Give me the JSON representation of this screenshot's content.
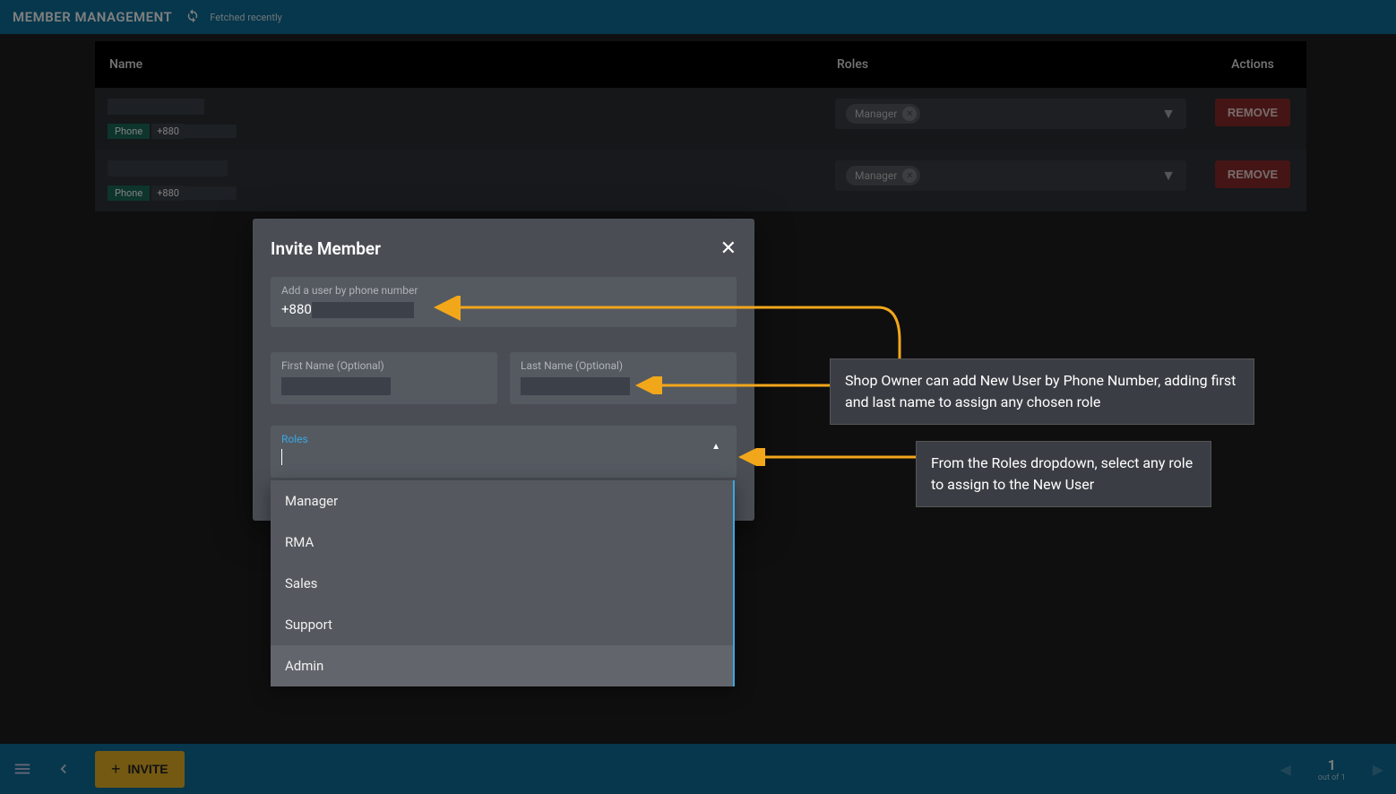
{
  "topbar": {
    "title": "MEMBER MANAGEMENT",
    "fetched": "Fetched recently"
  },
  "table": {
    "headers": {
      "name": "Name",
      "roles": "Roles",
      "actions": "Actions"
    },
    "rows": [
      {
        "phone_label": "Phone",
        "phone_prefix": "+880",
        "role": "Manager",
        "remove": "REMOVE"
      },
      {
        "phone_label": "Phone",
        "phone_prefix": "+880",
        "role": "Manager",
        "remove": "REMOVE"
      }
    ]
  },
  "modal": {
    "title": "Invite Member",
    "phone_label": "Add a user by phone number",
    "phone_value": "+880",
    "first_name_label": "First Name (Optional)",
    "last_name_label": "Last Name (Optional)",
    "roles_label": "Roles",
    "options": [
      "Manager",
      "RMA",
      "Sales",
      "Support",
      "Admin"
    ]
  },
  "bottombar": {
    "invite": "INVITE",
    "page": "1",
    "page_sub": "out of 1"
  },
  "annotations": {
    "a1": "Shop Owner can add New User by Phone Number, adding first and last name to assign any chosen role",
    "a2": "From the Roles dropdown, select any role to assign to the New User"
  }
}
